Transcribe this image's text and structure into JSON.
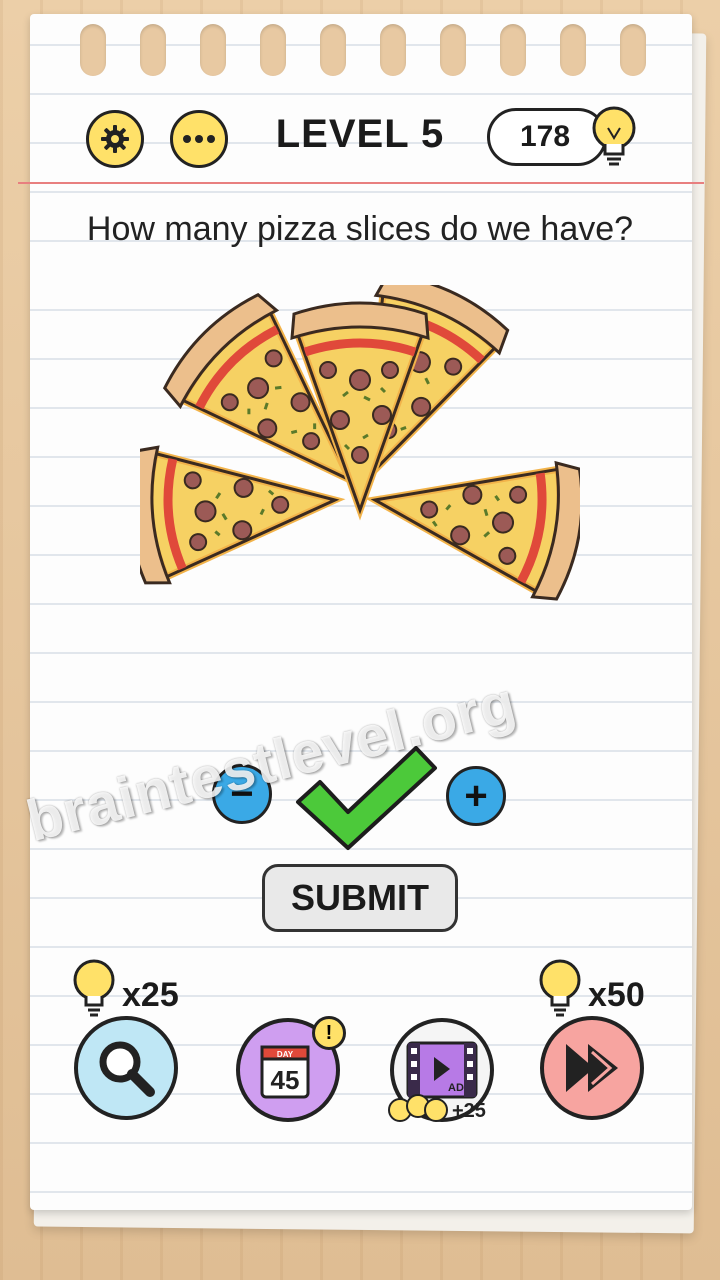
{
  "header": {
    "level_title": "LEVEL 5",
    "hint_count": "178"
  },
  "question": "How many pizza slices do we have?",
  "answer": {
    "minus_label": "−",
    "plus_label": "+",
    "submit_label": "SUBMIT"
  },
  "watermark": "braintestlevel.org",
  "tools": {
    "search_cost": "x25",
    "skip_cost": "x50",
    "calendar_day": "45",
    "calendar_month": "DAY",
    "calendar_badge": "!",
    "ad_label": "AD",
    "ad_reward": "+25"
  },
  "colors": {
    "accent_yellow": "#ffe169",
    "button_blue": "#3aa9e6",
    "check_green": "#4cc93a",
    "search_bg": "#bfe7f5",
    "calendar_bg": "#cf9ef0",
    "video_bg": "#f5f5f5",
    "skip_bg": "#f7a4a0",
    "margin_red": "#e87f7f"
  }
}
